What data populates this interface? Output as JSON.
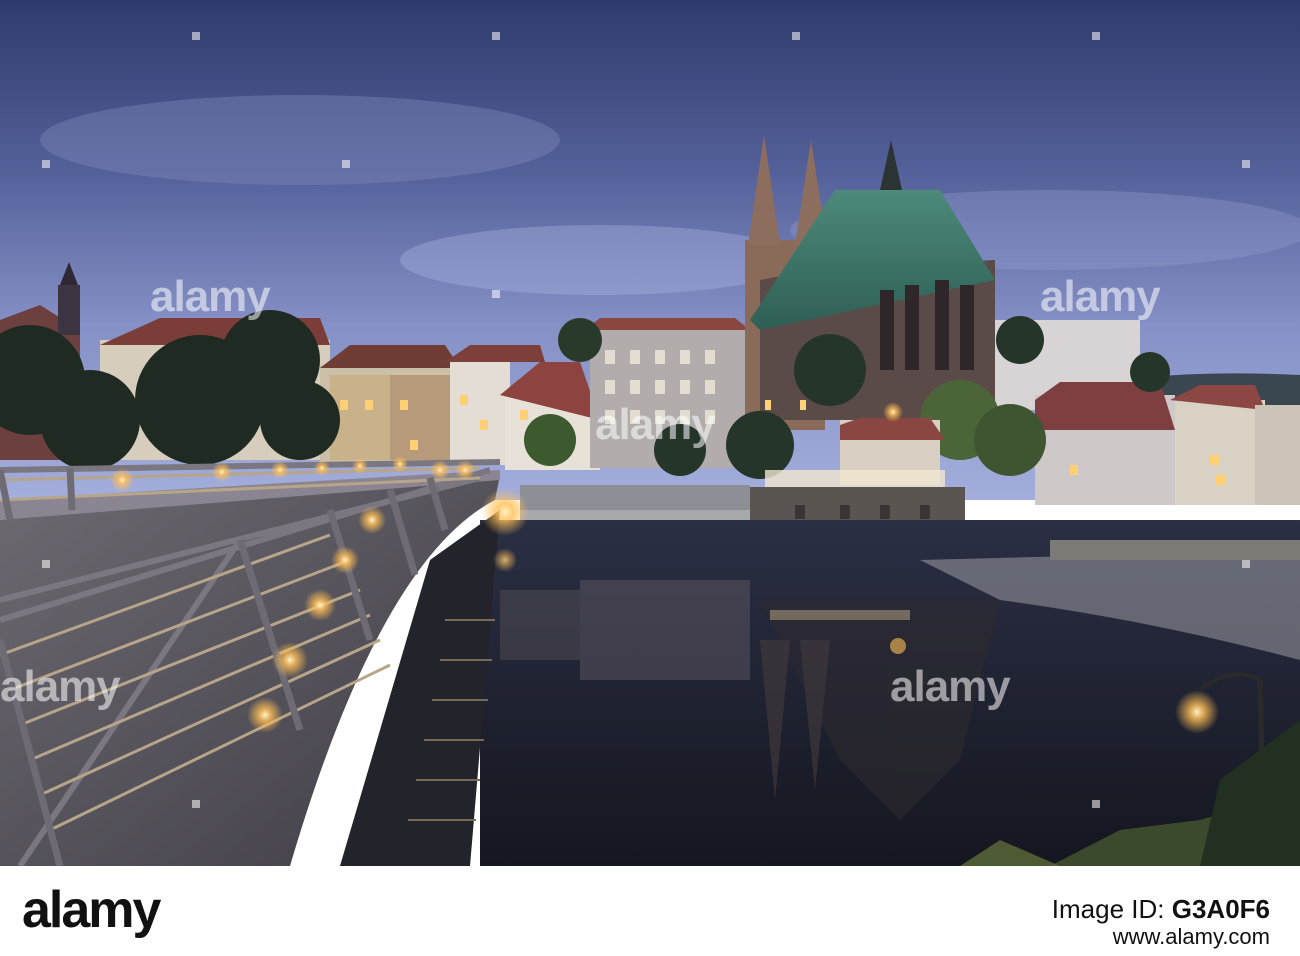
{
  "watermark": {
    "text": "alamy"
  },
  "footer": {
    "logo": "alamy",
    "image_id_label": "Image ID:",
    "image_id": "G3A0F6",
    "url": "www.alamy.com"
  },
  "colors": {
    "sky_top": "#3e4a7e",
    "sky_horizon": "#8d9ad0",
    "water": "#1c2030",
    "lamp_glow": "#ffbe55",
    "church_roof": "#3f7a6c",
    "footer_bg": "#ffffff"
  }
}
